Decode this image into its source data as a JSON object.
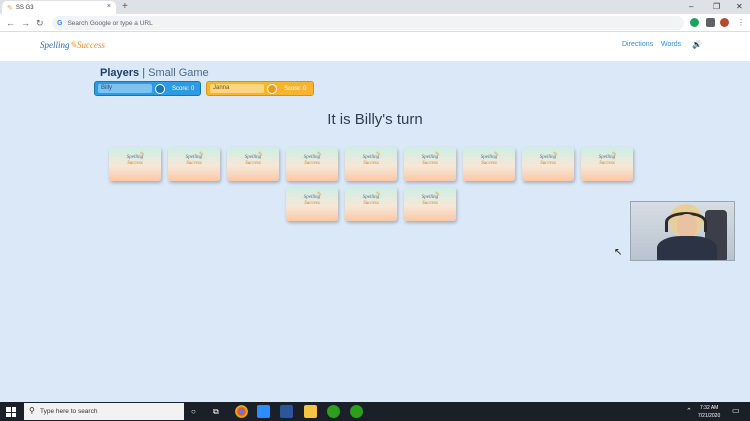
{
  "browser": {
    "tab_title": "SS G3",
    "tab_close": "×",
    "new_tab": "+",
    "window_controls": [
      "–",
      "❐",
      "✕"
    ],
    "nav": [
      "←",
      "→",
      "↻"
    ],
    "omnibox_prefix": "G",
    "omnibox_placeholder": "Search Google or type a URL"
  },
  "site": {
    "logo_text": "Spelling",
    "logo_text2": "Success",
    "nav_links": [
      "Directions",
      "Words"
    ],
    "sound_icon": "🔊"
  },
  "players": {
    "title": "Players",
    "separator": "|",
    "mode": "Small Game",
    "list": [
      {
        "name": "Billy",
        "score_label": "Score: 0"
      },
      {
        "name": "Janna",
        "score_label": "Score: 0"
      }
    ]
  },
  "turn_text": "It is Billy's turn",
  "card_face": {
    "line1": "Spelling",
    "line2": "Success",
    "pen": "✎"
  },
  "taskbar": {
    "search_placeholder": "Type here to search",
    "time": "7:32 AM",
    "date": "7/21/2020"
  },
  "colors": {
    "player1": "#2d9be3",
    "player2": "#f7b42c",
    "page_bg": "#dbe8f7",
    "link": "#2c8fd6"
  }
}
